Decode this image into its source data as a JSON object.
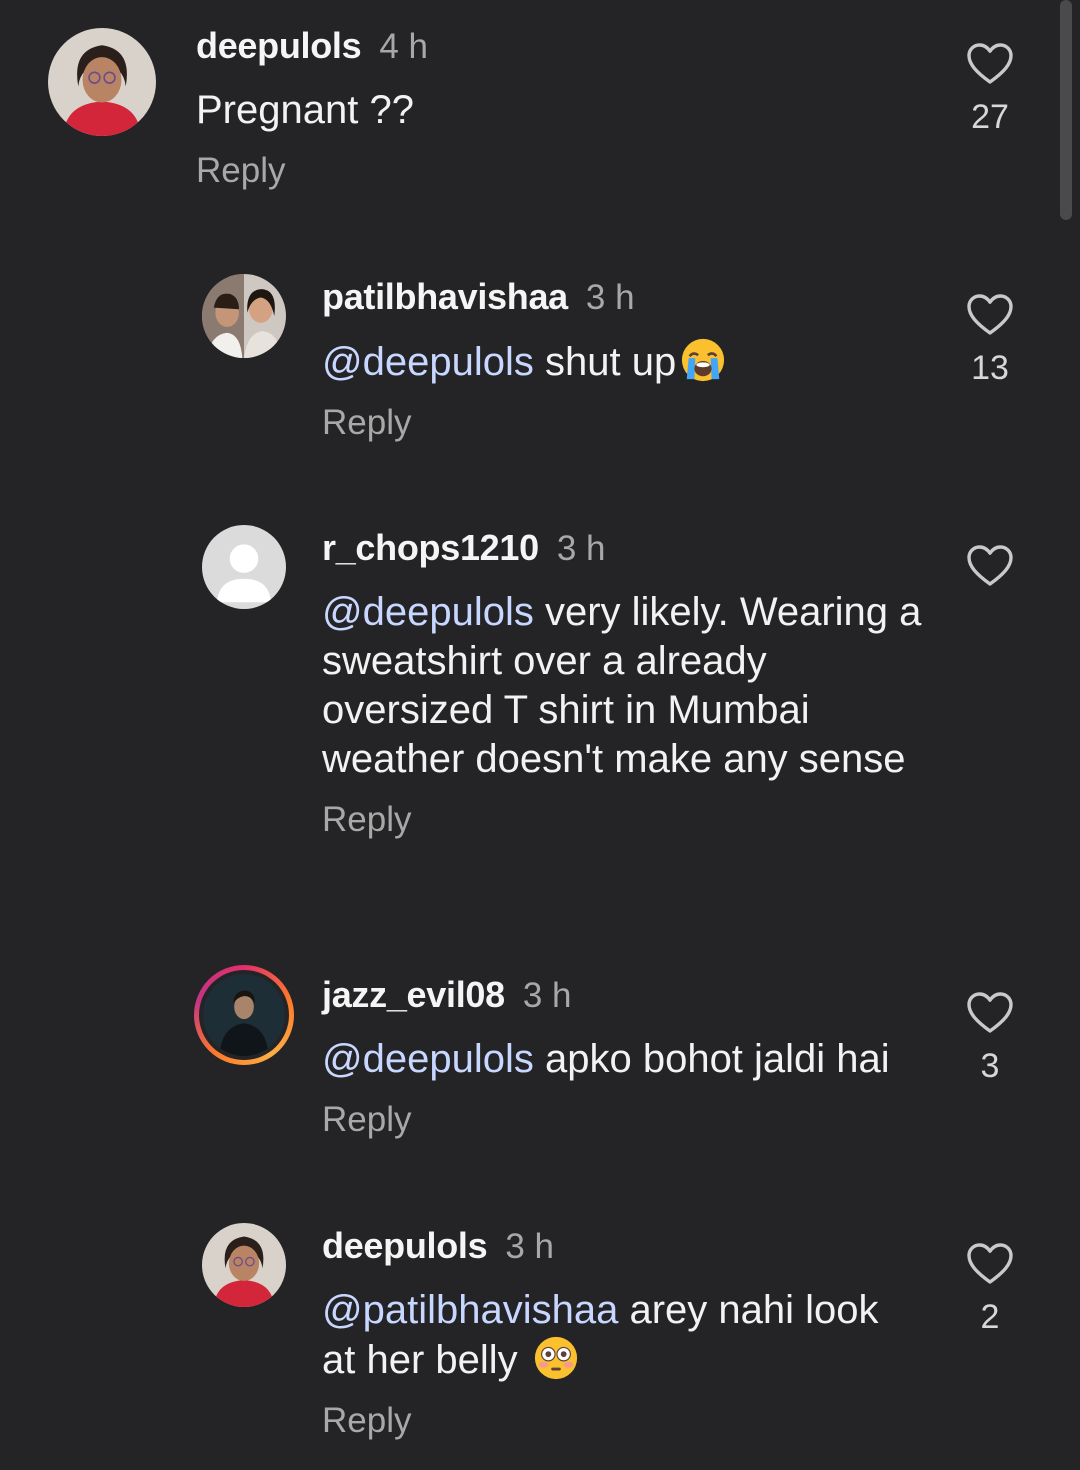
{
  "comments": [
    {
      "username": "deepulols",
      "time": "4 h",
      "mention": "",
      "text": "Pregnant ??",
      "reply": "Reply",
      "likes": "27",
      "emoji": ""
    },
    {
      "username": "patilbhavishaa",
      "time": "3 h",
      "mention": "@deepulols",
      "text": " shut up",
      "reply": "Reply",
      "likes": "13",
      "emoji": "loudly-crying-face-emoji"
    },
    {
      "username": "r_chops1210",
      "time": "3 h",
      "mention": "@deepulols",
      "text": " very likely. Wearing a sweatshirt over a already oversized T shirt in Mumbai weather doesn't make any sense",
      "reply": "Reply",
      "likes": "",
      "emoji": ""
    },
    {
      "username": "jazz_evil08",
      "time": "3 h",
      "mention": "@deepulols",
      "text": " apko bohot jaldi hai",
      "reply": "Reply",
      "likes": "3",
      "emoji": ""
    },
    {
      "username": "deepulols",
      "time": "3 h",
      "mention": "@patilbhavishaa",
      "text": " arey nahi look at her belly ",
      "reply": "Reply",
      "likes": "2",
      "emoji": "flushed-face-emoji"
    }
  ],
  "colors": {
    "background": "#242426",
    "mention": "#c8d7ff",
    "secondary_text": "#a8a8a8",
    "story_ring": "#e1306c"
  }
}
